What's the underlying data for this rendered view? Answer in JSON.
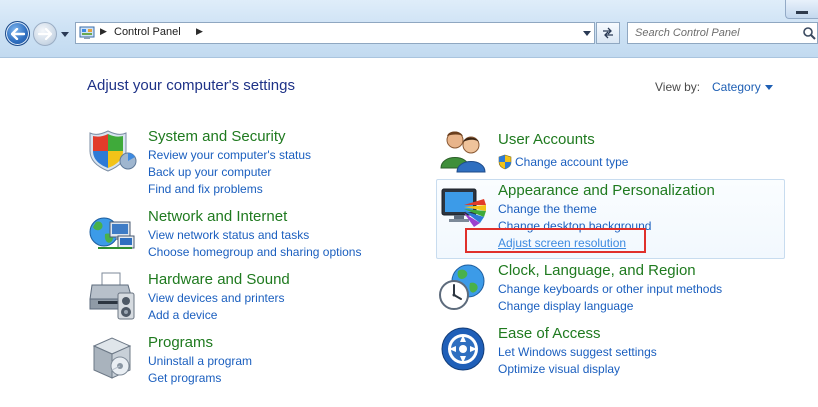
{
  "address_bar": {
    "path": "Control Panel",
    "search_placeholder": "Search Control Panel"
  },
  "page": {
    "title": "Adjust your computer's settings",
    "view_by_label": "View by:",
    "view_by_value": "Category"
  },
  "categories": {
    "system_security": {
      "title": "System and Security",
      "icon": "shield-icon",
      "links": [
        "Review your computer's status",
        "Back up your computer",
        "Find and fix problems"
      ]
    },
    "network_internet": {
      "title": "Network and Internet",
      "icon": "network-globe-icon",
      "links": [
        "View network status and tasks",
        "Choose homegroup and sharing options"
      ]
    },
    "hardware_sound": {
      "title": "Hardware and Sound",
      "icon": "printer-icon",
      "links": [
        "View devices and printers",
        "Add a device"
      ]
    },
    "programs": {
      "title": "Programs",
      "icon": "programs-box-icon",
      "links": [
        "Uninstall a program",
        "Get programs"
      ]
    },
    "user_accounts": {
      "title": "User Accounts",
      "icon": "users-icon",
      "links": [
        "Change account type"
      ]
    },
    "appearance": {
      "title": "Appearance and Personalization",
      "icon": "monitor-palette-icon",
      "links": [
        "Change the theme",
        "Change desktop background",
        "Adjust screen resolution"
      ]
    },
    "clock_region": {
      "title": "Clock, Language, and Region",
      "icon": "clock-globe-icon",
      "links": [
        "Change keyboards or other input methods",
        "Change display language"
      ]
    },
    "ease_access": {
      "title": "Ease of Access",
      "icon": "ease-of-access-icon",
      "links": [
        "Let Windows suggest settings",
        "Optimize visual display"
      ]
    }
  },
  "colors": {
    "link": "#1b5fbf",
    "category_title": "#1f7a1f",
    "page_title": "#1e3287",
    "highlight": "#e0302b"
  }
}
